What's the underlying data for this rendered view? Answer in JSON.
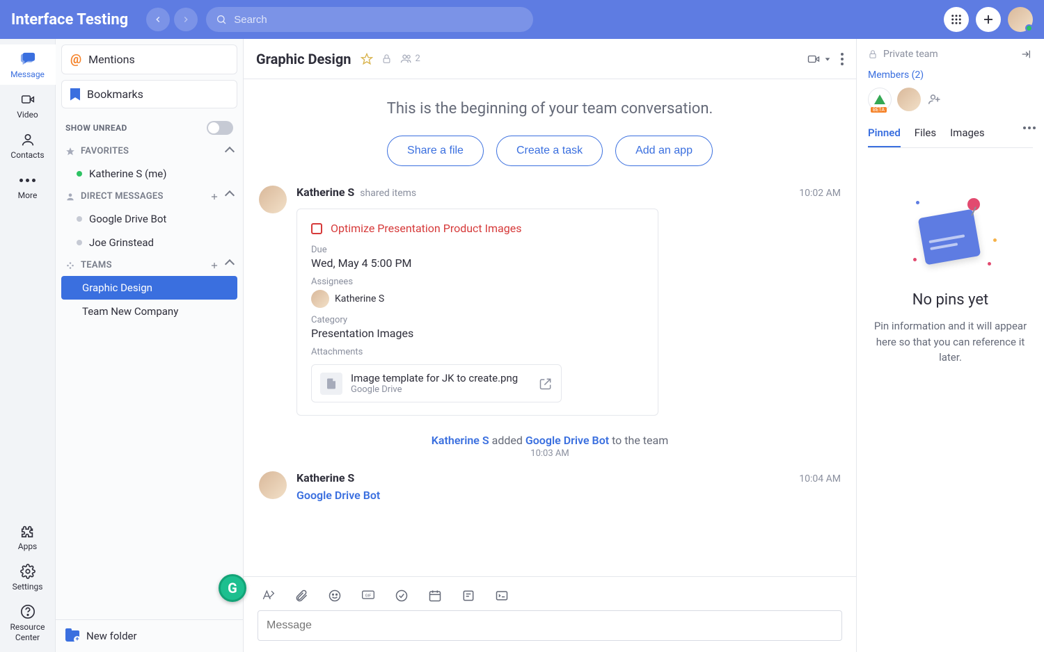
{
  "topbar": {
    "workspace": "Interface Testing",
    "search_placeholder": "Search"
  },
  "rail": {
    "message": "Message",
    "video": "Video",
    "contacts": "Contacts",
    "more": "More",
    "apps": "Apps",
    "settings": "Settings",
    "resource": "Resource Center"
  },
  "sidebar": {
    "mentions": "Mentions",
    "bookmarks": "Bookmarks",
    "show_unread": "SHOW UNREAD",
    "groups": {
      "favorites": "FAVORITES",
      "dms": "DIRECT MESSAGES",
      "teams": "TEAMS"
    },
    "favorites": [
      {
        "label": "Katherine S (me)",
        "presence": "green"
      }
    ],
    "dms": [
      {
        "label": "Google Drive Bot"
      },
      {
        "label": "Joe Grinstead"
      }
    ],
    "teams": [
      {
        "label": "Graphic Design",
        "active": true
      },
      {
        "label": "Team New Company"
      }
    ],
    "new_folder": "New folder"
  },
  "main": {
    "title": "Graphic Design",
    "member_count": "2",
    "hero_text": "This is the beginning of your team conversation.",
    "hero_buttons": {
      "share": "Share a file",
      "task": "Create a task",
      "app": "Add an app"
    },
    "composer_placeholder": "Message"
  },
  "posts": {
    "p1": {
      "author": "Katherine S",
      "sub": "shared items",
      "time": "10:02 AM",
      "task": {
        "title": "Optimize Presentation Product Images",
        "due_label": "Due",
        "due_val": "Wed, May 4 5:00 PM",
        "assignees_label": "Assignees",
        "assignee_name": "Katherine S",
        "category_label": "Category",
        "category_val": "Presentation Images",
        "attach_label": "Attachments",
        "attach_name": "Image template for JK to create.png",
        "attach_src": "Google Drive"
      }
    },
    "sys": {
      "actor": "Katherine S",
      "verb": " added ",
      "target": "Google Drive Bot",
      "suffix": " to the team",
      "time": "10:03 AM"
    },
    "p2": {
      "author": "Katherine S",
      "time": "10:04 AM",
      "link": "Google Drive Bot"
    }
  },
  "rpanel": {
    "privacy": "Private team",
    "members_label": "Members (2)",
    "tabs": {
      "pinned": "Pinned",
      "files": "Files",
      "images": "Images"
    },
    "empty_title": "No pins yet",
    "empty_body": "Pin information and it will appear here so that you can reference it later."
  }
}
